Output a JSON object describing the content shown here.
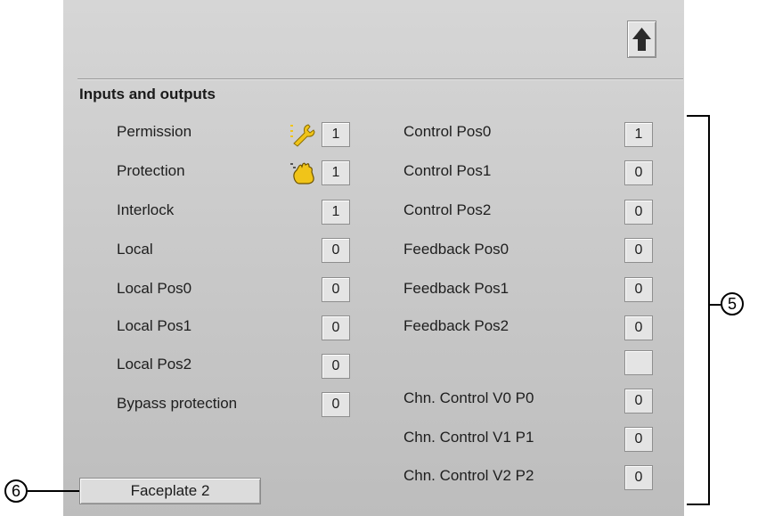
{
  "section_title": "Inputs and outputs",
  "left_rows": [
    {
      "label": "Permission",
      "value": "1",
      "icon": "wrench-icon"
    },
    {
      "label": "Protection",
      "value": "1",
      "icon": "hand-icon"
    },
    {
      "label": "Interlock",
      "value": "1"
    },
    {
      "label": "Local",
      "value": "0"
    },
    {
      "label": "Local Pos0",
      "value": "0"
    },
    {
      "label": "Local Pos1",
      "value": "0"
    },
    {
      "label": "Local Pos2",
      "value": "0"
    },
    {
      "label": "Bypass protection",
      "value": "0"
    }
  ],
  "right_rows": [
    {
      "label": "Control Pos0",
      "value": "1"
    },
    {
      "label": "Control Pos1",
      "value": "0"
    },
    {
      "label": "Control Pos2",
      "value": "0"
    },
    {
      "label": "Feedback Pos0",
      "value": "0"
    },
    {
      "label": "Feedback Pos1",
      "value": "0"
    },
    {
      "label": "Feedback Pos2",
      "value": "0"
    },
    {
      "label": "",
      "value": ""
    },
    {
      "label": "Chn. Control V0 P0",
      "value": "0"
    },
    {
      "label": "Chn. Control V1 P1",
      "value": "0"
    },
    {
      "label": "Chn. Control V2 P2",
      "value": "0"
    }
  ],
  "faceplate_button": "Faceplate 2",
  "up_button_icon": "arrow-up-icon",
  "callouts": {
    "five": "5",
    "six": "6"
  },
  "colors": {
    "panel": "#c9c9c9",
    "icon_yellow": "#f0c419"
  }
}
